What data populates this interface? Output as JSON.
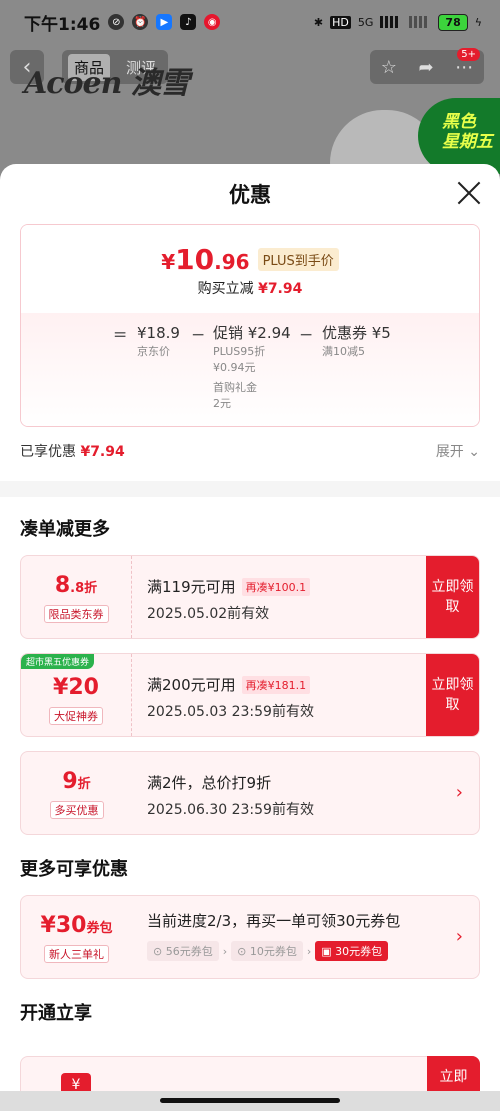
{
  "status_bar": {
    "time": "下午1:46",
    "network": "5G",
    "battery": "78"
  },
  "background_page": {
    "back_icon": "chevron-left-icon",
    "tabs": [
      "商品",
      "测评"
    ],
    "brand": "Acoen 澳雪",
    "cart_badge": "5+",
    "promo_badge_line1": "黑色",
    "promo_badge_line2": "星期五"
  },
  "sheet": {
    "title": "优惠",
    "price": {
      "yen": "¥",
      "int": "10",
      "dec": ".96",
      "plus_label": "PLUS到手价",
      "buy_reduce_label": "购买立减",
      "buy_reduce_value": "¥7.94"
    },
    "breakdown": {
      "eq": "=",
      "jd_price": "¥18.9",
      "jd_label": "京东价",
      "minus": "−",
      "promo_value": "促销 ¥2.94",
      "promo_line1": "PLUS95折",
      "promo_line2": "¥0.94元",
      "promo_line3": "首购礼金",
      "promo_line4": "2元",
      "coupon_value": "优惠券 ¥5",
      "coupon_line1": "满10减5"
    },
    "enjoyed_label": "已享优惠",
    "enjoyed_value": "¥7.94",
    "expand_label": "展开 ⌄",
    "section_combine": "凑单减更多",
    "coupons": [
      {
        "value_big": "8",
        "value_small": ".8折",
        "type": "限品类东券",
        "condition": "满119元可用",
        "need": "再凑¥100.1",
        "expiry": "2025.05.02前有效",
        "action": "立即领取"
      },
      {
        "corner": "超市黑五优惠券",
        "value_big": "¥20",
        "value_small": "",
        "type": "大促神券",
        "condition": "满200元可用",
        "need": "再凑¥181.1",
        "expiry": "2025.05.03 23:59前有效",
        "action": "立即领取"
      },
      {
        "value_big": "9",
        "value_small": "折",
        "type": "多买优惠",
        "condition": "满2件，总价打9折",
        "expiry": "2025.06.30 23:59前有效"
      }
    ],
    "section_more": "更多可享优惠",
    "pack": {
      "value_big": "¥30",
      "value_small": "券包",
      "type": "新人三单礼",
      "condition": "当前进度2/3，再买一单可领30元券包",
      "steps": [
        "56元券包",
        "10元券包",
        "30元券包"
      ]
    },
    "section_open": "开通立享",
    "partial_action": "立即"
  },
  "colors": {
    "accent": "#e41d2d",
    "plus_tag_bg": "#fbecd0",
    "green_tag": "#2bb24c"
  }
}
